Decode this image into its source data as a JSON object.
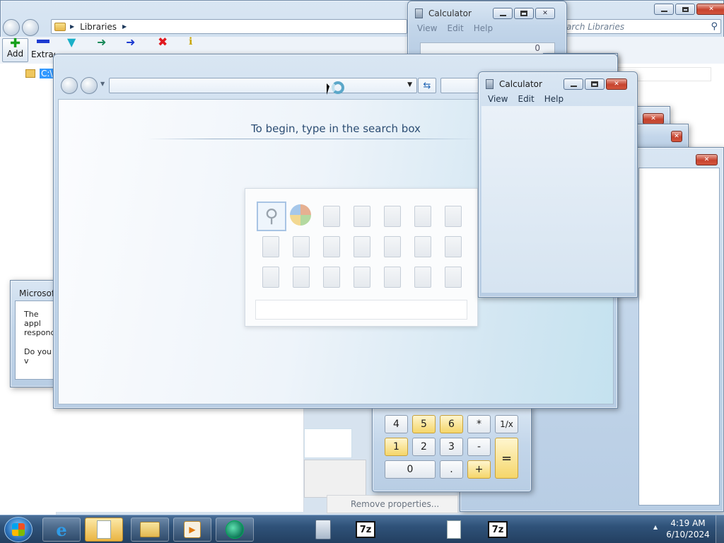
{
  "explorer": {
    "breadcrumb_root": "Libraries",
    "search_placeholder": "arch Libraries",
    "toolbar": {
      "add_label": "Add",
      "extract_label": "Extrac"
    },
    "tree_item": "C:\\"
  },
  "calc_back": {
    "title": "Calculator",
    "menu": [
      "View",
      "Edit",
      "Help"
    ],
    "display": "0"
  },
  "calc_front": {
    "title": "Calculator",
    "menu": [
      "View",
      "Edit",
      "Help"
    ]
  },
  "calc_keys": {
    "row1": [
      "4",
      "5",
      "6",
      "*",
      "1/x"
    ],
    "row2": [
      "1",
      "2",
      "3",
      "-"
    ],
    "row3": [
      "0",
      ".",
      "+"
    ],
    "equals": "="
  },
  "search_window": {
    "hint": "To begin, type in the search box"
  },
  "dialog": {
    "title": "Microsof",
    "line1": "The appl",
    "line2": "respond",
    "line3": "Do you v"
  },
  "remove_properties": "Remove properties...",
  "clock": {
    "time": "4:19 AM",
    "date": "6/10/2024"
  },
  "colors": {
    "taskbar": "#2f5279",
    "close_button": "#c7432e",
    "calc_highlight": "#f5d66a"
  }
}
